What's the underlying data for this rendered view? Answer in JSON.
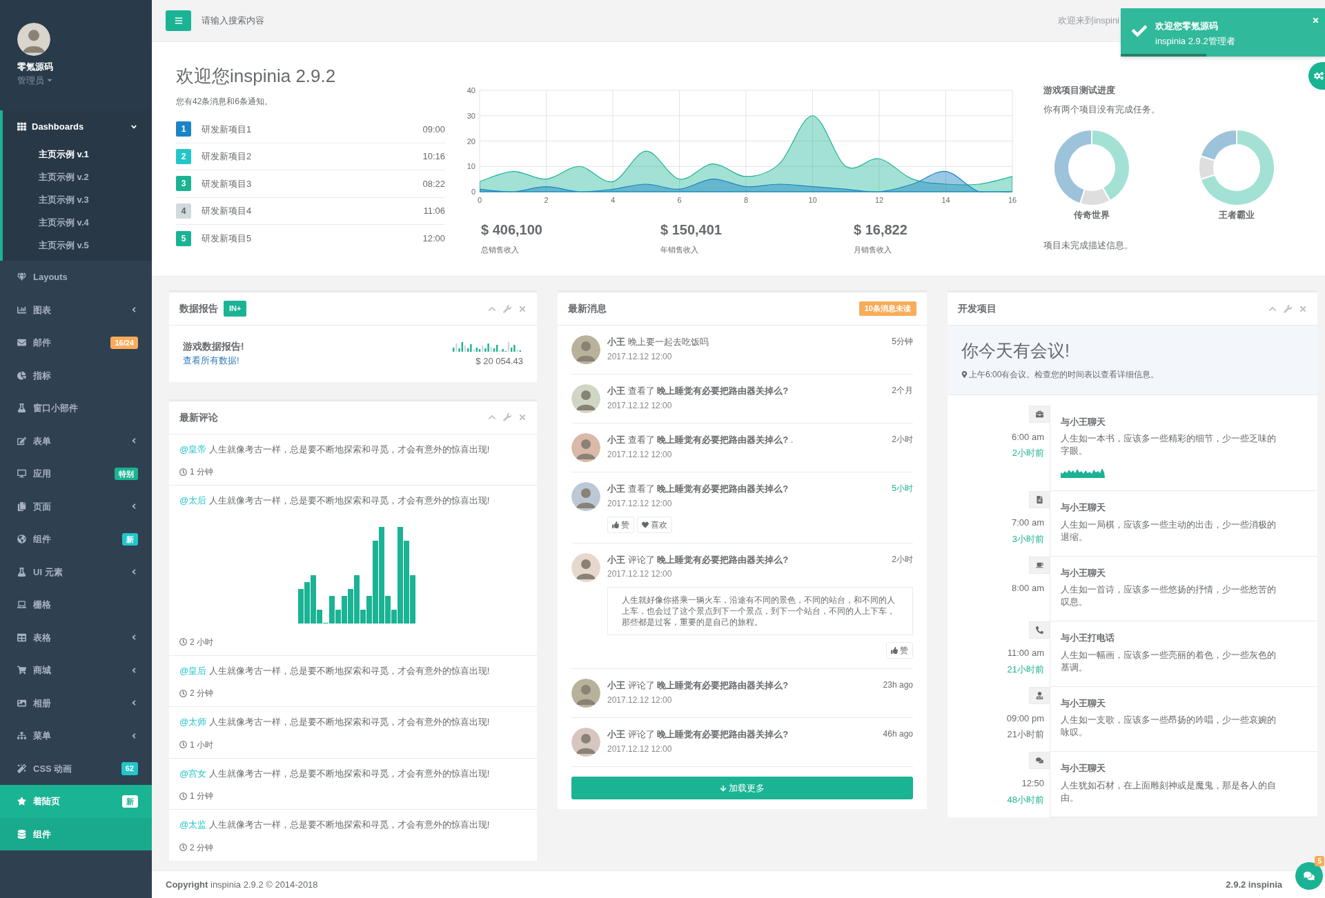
{
  "sidebar": {
    "profile": {
      "name": "零氪源码",
      "role": "管理员"
    },
    "items": [
      {
        "label": "Dashboards",
        "kind": "group",
        "selected": true,
        "expanded": true,
        "children": [
          {
            "label": "主页示例 v.1",
            "selected": true
          },
          {
            "label": "主页示例 v.2",
            "selected": false
          },
          {
            "label": "主页示例 v.3",
            "selected": false
          },
          {
            "label": "主页示例 v.4",
            "selected": false
          },
          {
            "label": "主页示例 v.5",
            "selected": false
          }
        ]
      },
      {
        "label": "Layouts",
        "kind": "link",
        "selected": false
      },
      {
        "label": "图表",
        "kind": "submenu",
        "selected": false
      },
      {
        "label": "邮件",
        "kind": "link",
        "selected": false,
        "badge": {
          "text": "16/24",
          "color": "#f8ac59"
        }
      },
      {
        "label": "指标",
        "kind": "link",
        "selected": false
      },
      {
        "label": "窗口小部件",
        "kind": "link",
        "selected": false
      },
      {
        "label": "表单",
        "kind": "submenu",
        "selected": false
      },
      {
        "label": "应用",
        "kind": "link",
        "selected": false,
        "badge": {
          "text": "特别",
          "color": "#1ab394"
        }
      },
      {
        "label": "页面",
        "kind": "submenu",
        "selected": false
      },
      {
        "label": "组件",
        "kind": "link",
        "selected": false,
        "badge": {
          "text": "新",
          "color": "#23c6c8"
        }
      },
      {
        "label": "UI 元素",
        "kind": "submenu",
        "selected": false
      },
      {
        "label": "栅格",
        "kind": "link",
        "selected": false
      },
      {
        "label": "表格",
        "kind": "submenu",
        "selected": false
      },
      {
        "label": "商城",
        "kind": "submenu",
        "selected": false
      },
      {
        "label": "相册",
        "kind": "submenu",
        "selected": false
      },
      {
        "label": "菜单",
        "kind": "submenu",
        "selected": false
      },
      {
        "label": "CSS 动画",
        "kind": "link",
        "selected": false,
        "badge": {
          "text": "62",
          "color": "#23c6c8"
        }
      },
      {
        "label": "着陆页",
        "kind": "landing",
        "badge": {
          "text": "新",
          "color": "#ffffff"
        }
      },
      {
        "label": "组件",
        "kind": "special"
      }
    ]
  },
  "navbar": {
    "search_placeholder": "请输入搜索内容",
    "welcome": "欢迎来到inspini"
  },
  "toast": {
    "title": "欢迎您零氪源码",
    "message": "inspinia 2.9.2管理者",
    "level": 0.42
  },
  "header": {
    "title": "欢迎您inspinia 2.9.2",
    "subtitle": "您有42条消息和6条通知。",
    "projects": [
      {
        "number": "1",
        "name": "研发新项目1",
        "time": "09:00",
        "color": "#1c84c6"
      },
      {
        "number": "2",
        "name": "研发新项目2",
        "time": "10:16",
        "color": "#23c6c8"
      },
      {
        "number": "3",
        "name": "研发新项目3",
        "time": "08:22",
        "color": "#1ab394"
      },
      {
        "number": "4",
        "name": "研发新项目4",
        "time": "11:06",
        "color": "#d1dade"
      },
      {
        "number": "5",
        "name": "研发新项目5",
        "time": "12:00",
        "color": "#1ab394"
      }
    ],
    "chart_data": {
      "type": "area",
      "grid": true,
      "x": [
        0,
        1,
        2,
        3,
        4,
        5,
        6,
        7,
        8,
        9,
        10,
        11,
        12,
        13,
        14,
        15,
        16
      ],
      "xlim": [
        0,
        16
      ],
      "ylim": [
        0,
        40
      ],
      "xticks": [
        0,
        2,
        4,
        6,
        8,
        10,
        12,
        14,
        16
      ],
      "yticks": [
        0,
        10,
        20,
        30,
        40
      ],
      "series": [
        {
          "color": "#1ab394",
          "values": [
            4,
            8,
            5,
            10,
            4,
            16,
            5,
            11,
            6,
            11,
            30,
            10,
            13,
            5,
            3,
            3,
            6
          ]
        },
        {
          "color": "#1c84c6",
          "values": [
            1,
            0,
            2,
            0,
            1,
            3,
            1,
            5,
            2,
            3,
            2,
            1,
            0,
            3,
            8,
            0,
            0
          ]
        }
      ]
    },
    "stats": [
      {
        "value": "$ 406,100",
        "label": "总销售收入"
      },
      {
        "value": "$ 150,401",
        "label": "年销售收入"
      },
      {
        "value": "$ 16,822",
        "label": "月销售收入"
      }
    ],
    "progress": {
      "title": "游戏项目测试进度",
      "subtitle": "你有两个项目没有完成任务。",
      "games": [
        {
          "name": "传奇世界"
        },
        {
          "name": "王者霸业"
        }
      ],
      "note": "项目未完成描述信息。"
    }
  },
  "report": {
    "title": "数据报告",
    "badge": "IN+",
    "heading": "游戏数据报告!",
    "link": "查看所有数据!",
    "amount": "$ 20 054.43"
  },
  "comments": {
    "title": "最新评论",
    "items": [
      {
        "user": "@皇帝",
        "text": "人生就像考古一样，总是要不断地探索和寻觅，才会有意外的惊喜出现!",
        "time": "1 分钟",
        "kind": "text"
      },
      {
        "user": "@太后",
        "text": "人生就像考古一样，总是要不断地探索和寻觅，才会有意外的惊喜出现!",
        "time": "2 小时",
        "kind": "chart"
      },
      {
        "user": "@皇后",
        "text": "人生就像考古一样，总是要不断地探索和寻觅，才会有意外的惊喜出现!",
        "time": "2 分钟",
        "kind": "text"
      },
      {
        "user": "@太师",
        "text": "人生就像考古一样，总是要不断地探索和寻觅，才会有意外的惊喜出现!",
        "time": "1 小时",
        "kind": "text"
      },
      {
        "user": "@宫女",
        "text": "人生就像考古一样，总是要不断地探索和寻觅，才会有意外的惊喜出现!",
        "time": "1 分钟",
        "kind": "text"
      },
      {
        "user": "@太监",
        "text": "人生就像考古一样，总是要不断地探索和寻觅，才会有意外的惊喜出现!",
        "time": "2 分钟",
        "kind": "text"
      }
    ]
  },
  "messages": {
    "title": "最新消息",
    "badge": "10条消息未读",
    "load_more": "加载更多",
    "items": [
      {
        "kind": "plain",
        "text": "**小王** 晚上要一起去吃饭吗",
        "date": "2017.12.12 12:00",
        "time": "5分钟",
        "highlight": false
      },
      {
        "kind": "plain",
        "text": "**小王** 查看了 **晚上睡觉有必要把路由器关掉么?**",
        "date": "2017.12.12 12:00",
        "time": "2个月",
        "highlight": false
      },
      {
        "kind": "plain",
        "text": "**小王** 查看了 **晚上睡觉有必要把路由器关掉么?** .",
        "date": "2017.12.12 12:00",
        "time": "2小时",
        "highlight": false
      },
      {
        "kind": "actions",
        "text": "**小王** 查看了 **晚上睡觉有必要把路由器关掉么?**",
        "date": "2017.12.12 12:00",
        "time": "5小时",
        "highlight": true,
        "actions": [
          "赞",
          "喜欢"
        ]
      },
      {
        "kind": "quote",
        "text": "**小王** 评论了 **晚上睡觉有必要把路由器关掉么?**",
        "date": "2017.12.12 12:00",
        "time": "2小时",
        "highlight": false,
        "quote": "人生就好像你搭乘一辆火车，沿途有不同的景色，不同的站台，和不同的人上车，也会过了这个景点到下一个景点，到下一个站台，不同的人上下车，那些都是过客，重要的是自己的旅程。",
        "actions": [
          "赞"
        ]
      },
      {
        "kind": "plain",
        "text": "**小王** 评论了 **晚上睡觉有必要把路由器关掉么?**",
        "date": "2017.12.12 12:00",
        "time": "23h ago",
        "highlight": false
      },
      {
        "kind": "plain",
        "text": "**小王** 评论了 **晚上睡觉有必要把路由器关掉么?**",
        "date": "2017.12.12 12:00",
        "time": "46h ago",
        "highlight": false
      }
    ]
  },
  "timeline": {
    "title": "开发项目",
    "alert_title": "你今天有会议!",
    "alert_text": "上午6:00有会议。检查您的时间表以查看详细信息。",
    "items": [
      {
        "kind": "sparkline",
        "time": "6:00 am",
        "ago": "2小时前",
        "highlight": true,
        "title": "与小王聊天",
        "text": "人生如一本书，应该多一些精彩的细节，少一些乏味的字眼。"
      },
      {
        "kind": "plain",
        "time": "7:00 am",
        "ago": "3小时前",
        "highlight": true,
        "title": "与小王聊天",
        "text": "人生如一局棋，应该多一些主动的出击，少一些消极的退缩。"
      },
      {
        "kind": "plain",
        "time": "8:00 am",
        "title": "与小王聊天",
        "text": "人生如一首诗，应该多一些悠扬的抒情，少一些愁苦的叹息。"
      },
      {
        "kind": "plain",
        "time": "11:00 am",
        "ago": "21小时前",
        "highlight": true,
        "title": "与小王打电话",
        "text": "人生如一幅画，应该多一些亮丽的着色，少一些灰色的基调。"
      },
      {
        "kind": "plain",
        "time": "09:00 pm",
        "ago": "21小时前",
        "highlight": false,
        "title": "与小王聊天",
        "text": "人生如一支歌，应该多一些昂扬的吟唱，少一些哀婉的咏叹。"
      },
      {
        "kind": "plain",
        "time": "12:50",
        "ago": "48小时前",
        "highlight": true,
        "title": "与小王聊天",
        "text": "人生犹如石材，在上面雕刻神或是魔鬼，那是各人的自由。"
      }
    ]
  },
  "footer": {
    "copyright": "**Copyright** inspinia 2.9.2 © 2014-2018",
    "version": "2.9.2 inspinia"
  },
  "chat": {
    "badge": "5"
  }
}
